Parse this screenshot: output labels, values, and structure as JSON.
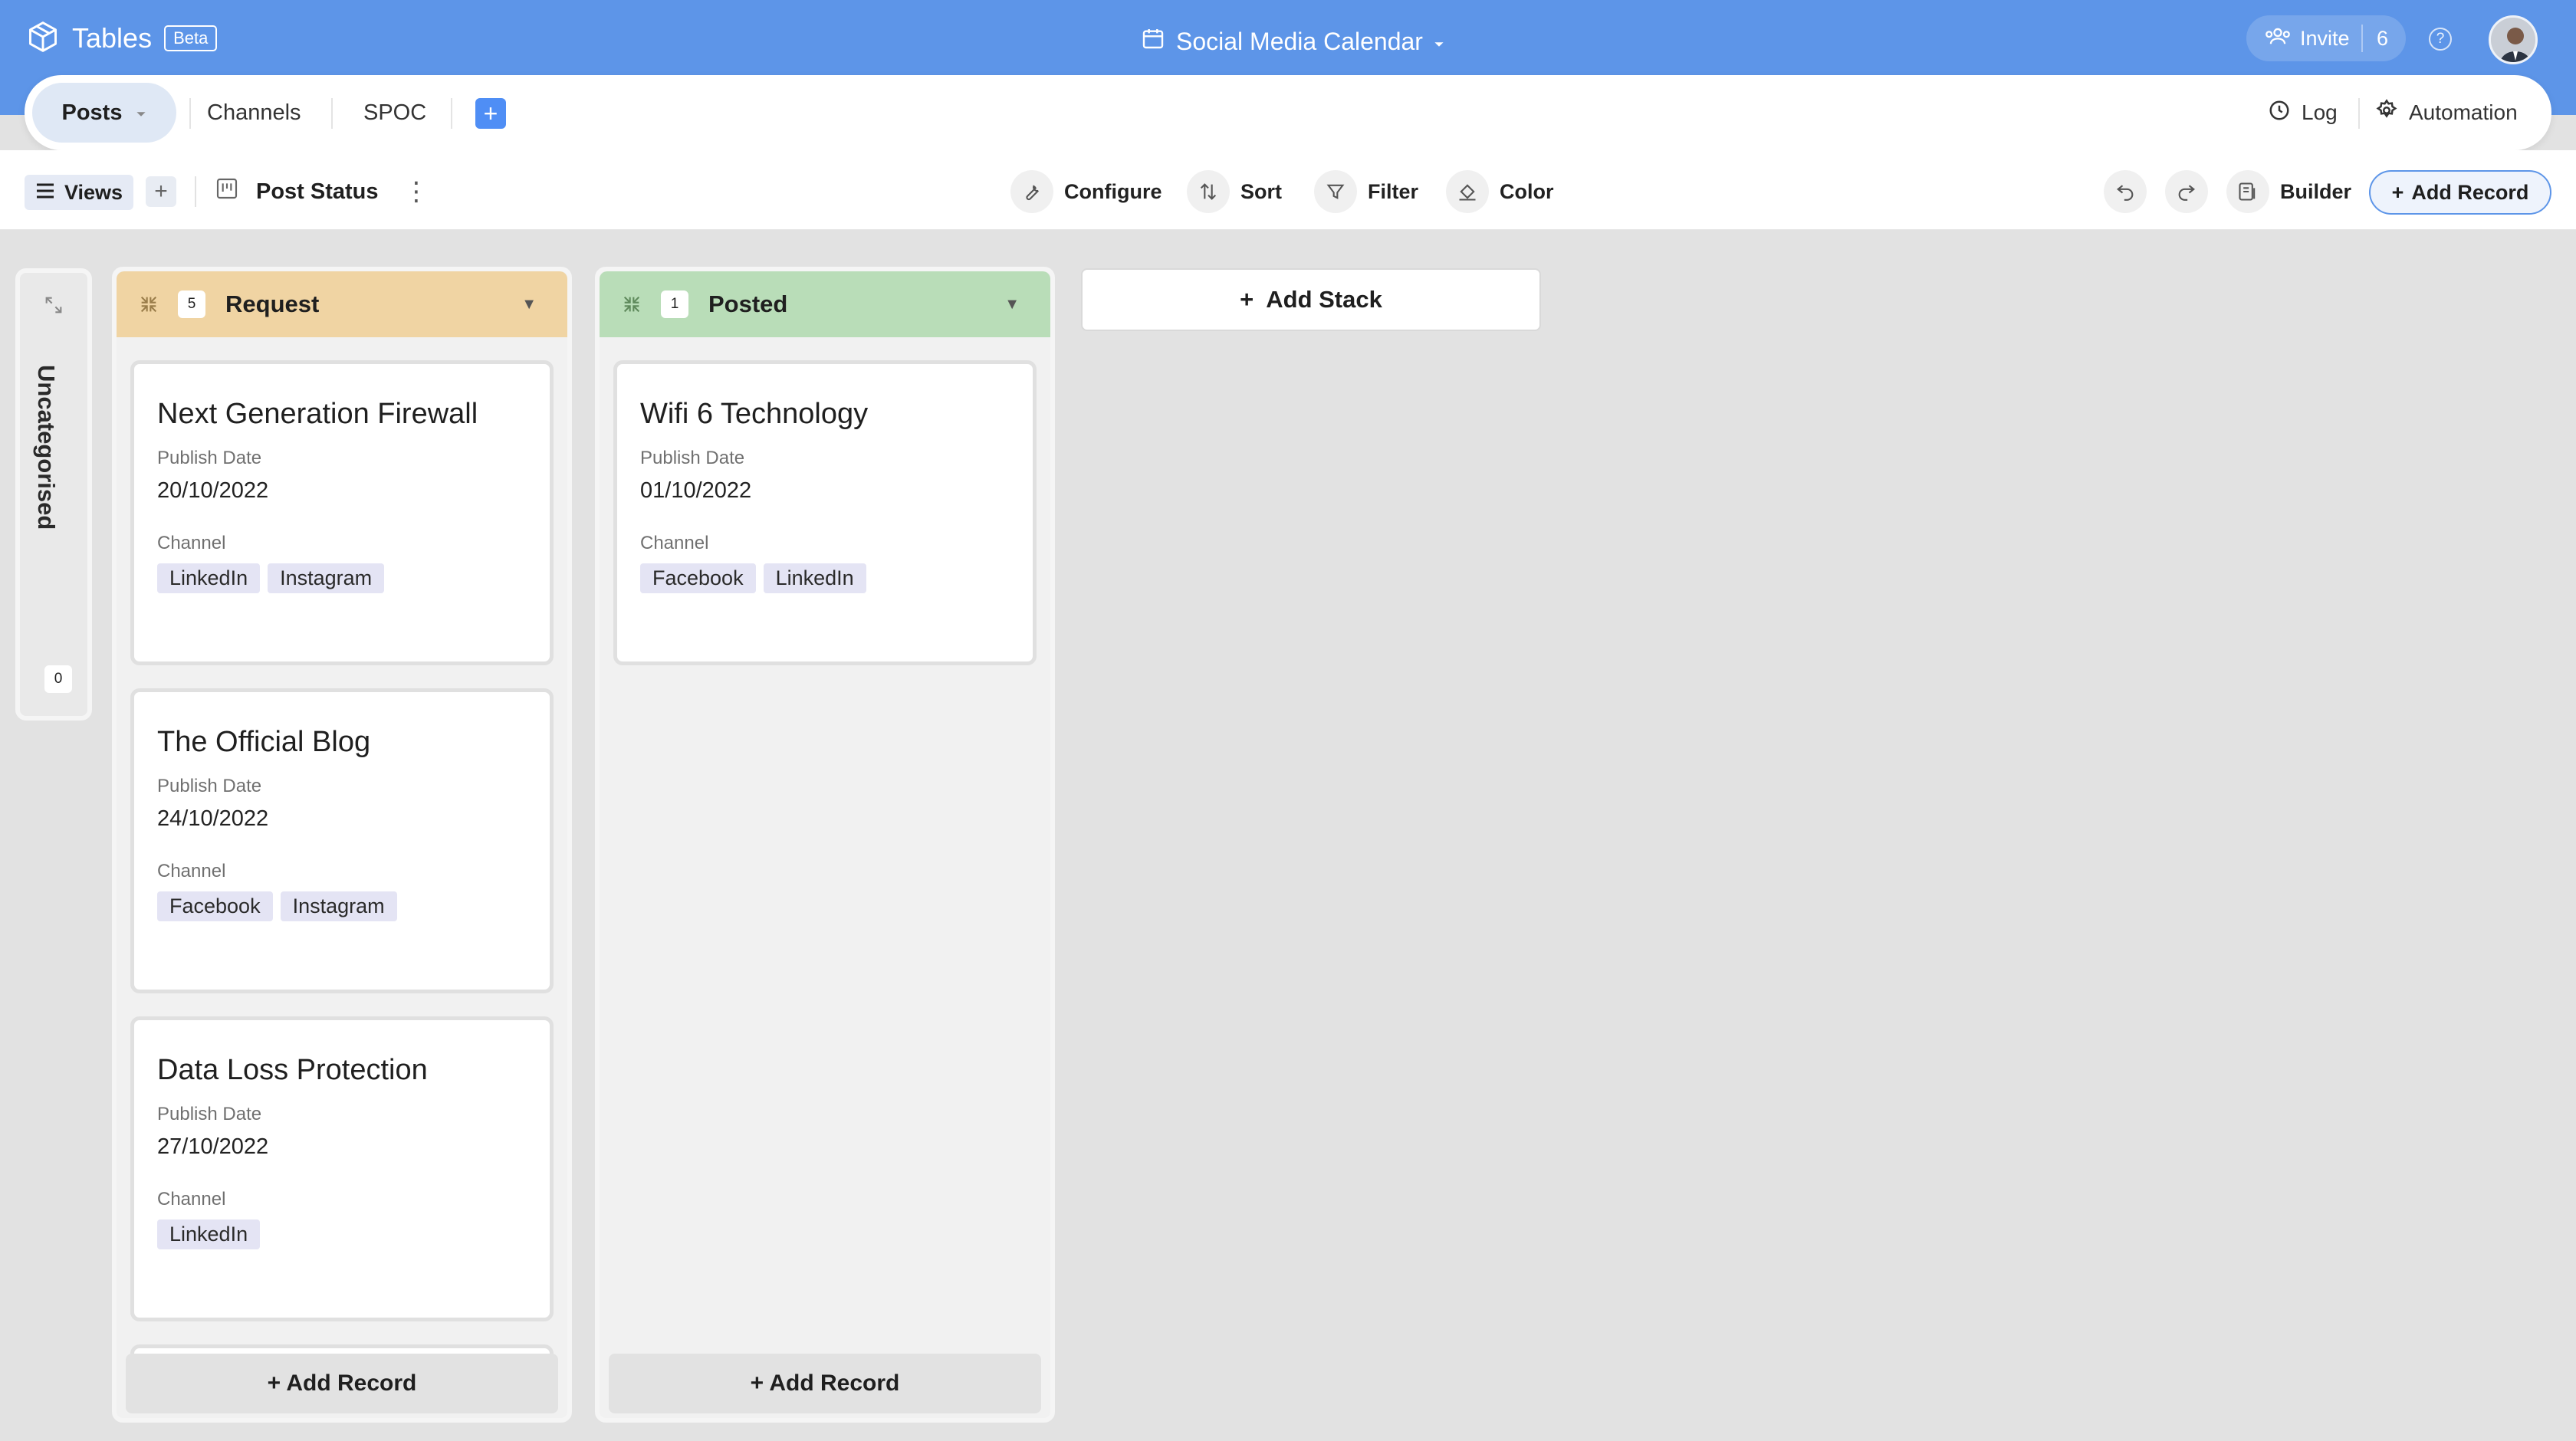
{
  "app": {
    "name": "Tables",
    "badge": "Beta"
  },
  "document": {
    "title": "Social Media Calendar"
  },
  "header": {
    "invite_label": "Invite",
    "invite_count": "6",
    "help_label": "?"
  },
  "tabs": [
    {
      "label": "Posts",
      "active": true
    },
    {
      "label": "Channels",
      "active": false
    },
    {
      "label": "SPOC",
      "active": false
    }
  ],
  "tabbar_right": {
    "log_label": "Log",
    "automation_label": "Automation"
  },
  "toolbar": {
    "views_label": "Views",
    "view_name": "Post Status",
    "configure_label": "Configure",
    "sort_label": "Sort",
    "filter_label": "Filter",
    "color_label": "Color",
    "builder_label": "Builder",
    "add_record_label": "Add Record"
  },
  "uncategorised": {
    "label": "Uncategorised",
    "count": "0"
  },
  "stacks": [
    {
      "title": "Request",
      "count": "5",
      "color": "#f0d4a3",
      "add_record_label": "+ Add Record",
      "cards": [
        {
          "title": "Next Generation Firewall",
          "date_label": "Publish Date",
          "date": "20/10/2022",
          "channel_label": "Channel",
          "channels": [
            "LinkedIn",
            "Instagram"
          ]
        },
        {
          "title": "The Official Blog",
          "date_label": "Publish Date",
          "date": "24/10/2022",
          "channel_label": "Channel",
          "channels": [
            "Facebook",
            "Instagram"
          ]
        },
        {
          "title": "Data Loss Protection",
          "date_label": "Publish Date",
          "date": "27/10/2022",
          "channel_label": "Channel",
          "channels": [
            "LinkedIn"
          ]
        }
      ]
    },
    {
      "title": "Posted",
      "count": "1",
      "color": "#b9ddb8",
      "add_record_label": "+ Add Record",
      "cards": [
        {
          "title": "Wifi 6 Technology",
          "date_label": "Publish Date",
          "date": "01/10/2022",
          "channel_label": "Channel",
          "channels": [
            "Facebook",
            "LinkedIn"
          ]
        }
      ]
    }
  ],
  "add_stack_label": "Add Stack",
  "colors": {
    "header_bg": "#5d95e8",
    "accent": "#4f8ef5",
    "tag_bg": "#e4e4f4"
  }
}
